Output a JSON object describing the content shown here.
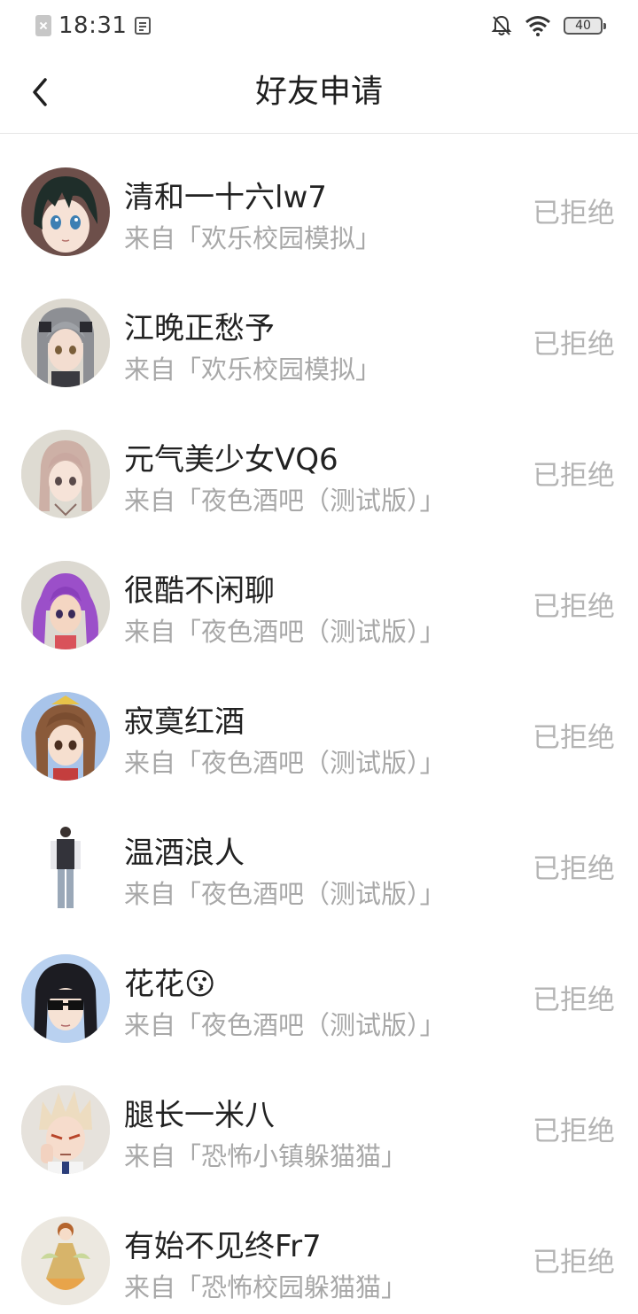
{
  "status_bar": {
    "time": "18:31",
    "battery": "40",
    "icons": [
      "sim-card-icon",
      "screenshot-icon",
      "mute-bell-icon",
      "wifi-icon",
      "battery-icon"
    ]
  },
  "header": {
    "title": "好友申请",
    "back_icon": "chevron-left-icon"
  },
  "requests": [
    {
      "name": "清和一十六lw7",
      "source": "来自「欢乐校园模拟」",
      "status": "已拒绝",
      "avatar": "anime-girl-dark-hair"
    },
    {
      "name": "江晚正愁予",
      "source": "来自「欢乐校园模拟」",
      "status": "已拒绝",
      "avatar": "anime-girl-gray-hair"
    },
    {
      "name": "元气美少女VQ6",
      "source": "来自「夜色酒吧（测试版）」",
      "status": "已拒绝",
      "avatar": "anime-girl-pink-hair"
    },
    {
      "name": "很酷不闲聊",
      "source": "来自「夜色酒吧（测试版）」",
      "status": "已拒绝",
      "avatar": "anime-girl-purple-hair"
    },
    {
      "name": "寂寞红酒",
      "source": "来自「夜色酒吧（测试版）」",
      "status": "已拒绝",
      "avatar": "anime-girl-brown-hair"
    },
    {
      "name": "温酒浪人",
      "source": "来自「夜色酒吧（测试版）」",
      "status": "已拒绝",
      "avatar": "full-body-character"
    },
    {
      "name": "花花😗",
      "source": "来自「夜色酒吧（测试版）」",
      "status": "已拒绝",
      "avatar": "anime-girl-sunglasses"
    },
    {
      "name": "腿长一米八",
      "source": "来自「恐怖小镇躲猫猫」",
      "status": "已拒绝",
      "avatar": "anime-boy-blond-hair"
    },
    {
      "name": "有始不见终Fr7",
      "source": "来自「恐怖校园躲猫猫」",
      "status": "已拒绝",
      "avatar": "fairy-character"
    }
  ],
  "colors": {
    "name_text": "#222222",
    "secondary_text": "#a8a8a8",
    "status_text": "#b4b4b4",
    "divider": "#e6e6e6"
  }
}
